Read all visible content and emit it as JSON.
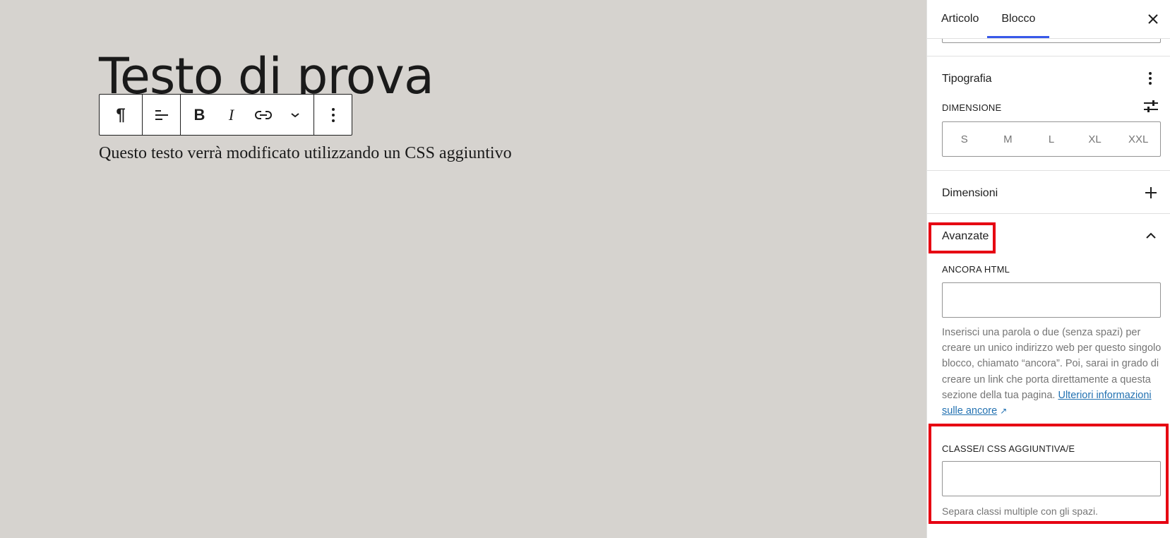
{
  "editor": {
    "title": "Testo di prova",
    "paragraph": "Questo testo verrà modificato utilizzando un CSS aggiuntivo"
  },
  "toolbar": {
    "paragraph_icon": "¶",
    "bold": "B",
    "italic": "I"
  },
  "sidebar": {
    "tabs": [
      {
        "label": "Articolo",
        "active": false
      },
      {
        "label": "Blocco",
        "active": true
      }
    ],
    "typography": {
      "title": "Tipografia",
      "size_label": "DIMENSIONE",
      "sizes": [
        "S",
        "M",
        "L",
        "XL",
        "XXL"
      ]
    },
    "dimensions": {
      "title": "Dimensioni"
    },
    "advanced": {
      "title": "Avanzate",
      "anchor_label": "ANCORA HTML",
      "anchor_value": "",
      "anchor_help": "Inserisci una parola o due (senza spazi) per creare un unico indirizzo web per questo singolo blocco, chiamato “ancora”. Poi, sarai in grado di creare un link che porta direttamente a questa sezione della tua pagina.",
      "anchor_link": "Ulteriori informazioni sulle ancore",
      "css_label": "CLASSE/I CSS AGGIUNTIVA/E",
      "css_value": "",
      "css_help": "Separa classi multiple con gli spazi."
    }
  },
  "colors": {
    "canvas_bg": "#d6d3cf",
    "accent": "#3858e9",
    "highlight": "#e60012",
    "link": "#2271b1"
  }
}
